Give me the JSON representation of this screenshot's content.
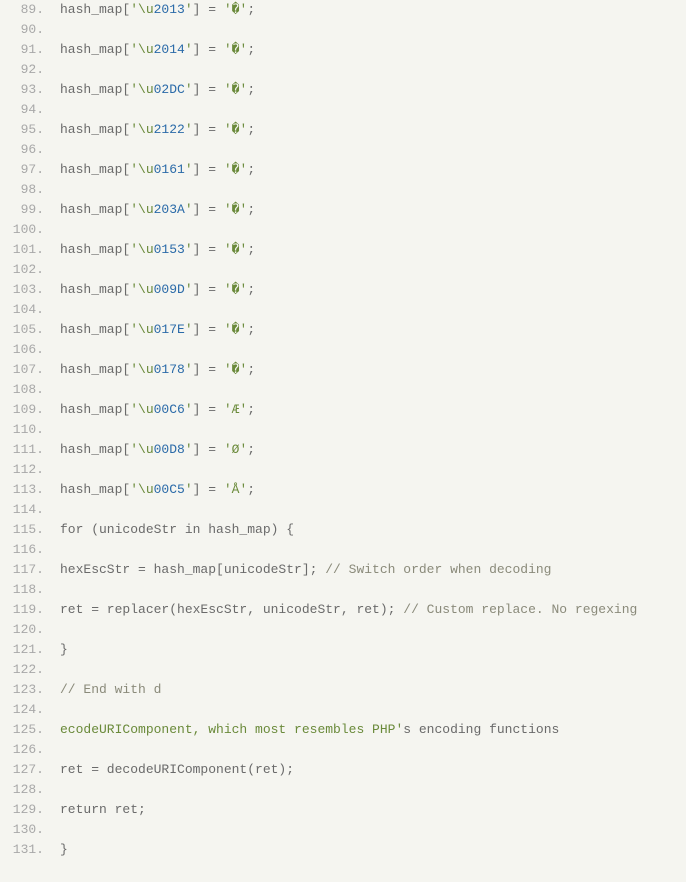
{
  "lines": [
    {
      "num": "89.",
      "tokens": [
        {
          "t": "hash_map[",
          "c": "plain"
        },
        {
          "t": "'\\u",
          "c": "str"
        },
        {
          "t": "2013",
          "c": "esc"
        },
        {
          "t": "'",
          "c": "str"
        },
        {
          "t": "] = ",
          "c": "plain"
        },
        {
          "t": "'�'",
          "c": "str"
        },
        {
          "t": ";",
          "c": "plain"
        }
      ]
    },
    {
      "num": "90.",
      "tokens": []
    },
    {
      "num": "91.",
      "tokens": [
        {
          "t": "hash_map[",
          "c": "plain"
        },
        {
          "t": "'\\u",
          "c": "str"
        },
        {
          "t": "2014",
          "c": "esc"
        },
        {
          "t": "'",
          "c": "str"
        },
        {
          "t": "] = ",
          "c": "plain"
        },
        {
          "t": "'�'",
          "c": "str"
        },
        {
          "t": ";",
          "c": "plain"
        }
      ]
    },
    {
      "num": "92.",
      "tokens": []
    },
    {
      "num": "93.",
      "tokens": [
        {
          "t": "hash_map[",
          "c": "plain"
        },
        {
          "t": "'\\u",
          "c": "str"
        },
        {
          "t": "02DC",
          "c": "esc"
        },
        {
          "t": "'",
          "c": "str"
        },
        {
          "t": "] = ",
          "c": "plain"
        },
        {
          "t": "'�'",
          "c": "str"
        },
        {
          "t": ";",
          "c": "plain"
        }
      ]
    },
    {
      "num": "94.",
      "tokens": []
    },
    {
      "num": "95.",
      "tokens": [
        {
          "t": "hash_map[",
          "c": "plain"
        },
        {
          "t": "'\\u",
          "c": "str"
        },
        {
          "t": "2122",
          "c": "esc"
        },
        {
          "t": "'",
          "c": "str"
        },
        {
          "t": "] = ",
          "c": "plain"
        },
        {
          "t": "'�'",
          "c": "str"
        },
        {
          "t": ";",
          "c": "plain"
        }
      ]
    },
    {
      "num": "96.",
      "tokens": []
    },
    {
      "num": "97.",
      "tokens": [
        {
          "t": "hash_map[",
          "c": "plain"
        },
        {
          "t": "'\\u",
          "c": "str"
        },
        {
          "t": "0161",
          "c": "esc"
        },
        {
          "t": "'",
          "c": "str"
        },
        {
          "t": "] = ",
          "c": "plain"
        },
        {
          "t": "'�'",
          "c": "str"
        },
        {
          "t": ";",
          "c": "plain"
        }
      ]
    },
    {
      "num": "98.",
      "tokens": []
    },
    {
      "num": "99.",
      "tokens": [
        {
          "t": "hash_map[",
          "c": "plain"
        },
        {
          "t": "'\\u",
          "c": "str"
        },
        {
          "t": "203A",
          "c": "esc"
        },
        {
          "t": "'",
          "c": "str"
        },
        {
          "t": "] = ",
          "c": "plain"
        },
        {
          "t": "'�'",
          "c": "str"
        },
        {
          "t": ";",
          "c": "plain"
        }
      ]
    },
    {
      "num": "100.",
      "tokens": []
    },
    {
      "num": "101.",
      "tokens": [
        {
          "t": "hash_map[",
          "c": "plain"
        },
        {
          "t": "'\\u",
          "c": "str"
        },
        {
          "t": "0153",
          "c": "esc"
        },
        {
          "t": "'",
          "c": "str"
        },
        {
          "t": "] = ",
          "c": "plain"
        },
        {
          "t": "'�'",
          "c": "str"
        },
        {
          "t": ";",
          "c": "plain"
        }
      ]
    },
    {
      "num": "102.",
      "tokens": []
    },
    {
      "num": "103.",
      "tokens": [
        {
          "t": "hash_map[",
          "c": "plain"
        },
        {
          "t": "'\\u",
          "c": "str"
        },
        {
          "t": "009D",
          "c": "esc"
        },
        {
          "t": "'",
          "c": "str"
        },
        {
          "t": "] = ",
          "c": "plain"
        },
        {
          "t": "'�'",
          "c": "str"
        },
        {
          "t": ";",
          "c": "plain"
        }
      ]
    },
    {
      "num": "104.",
      "tokens": []
    },
    {
      "num": "105.",
      "tokens": [
        {
          "t": "hash_map[",
          "c": "plain"
        },
        {
          "t": "'\\u",
          "c": "str"
        },
        {
          "t": "017E",
          "c": "esc"
        },
        {
          "t": "'",
          "c": "str"
        },
        {
          "t": "] = ",
          "c": "plain"
        },
        {
          "t": "'�'",
          "c": "str"
        },
        {
          "t": ";",
          "c": "plain"
        }
      ]
    },
    {
      "num": "106.",
      "tokens": []
    },
    {
      "num": "107.",
      "tokens": [
        {
          "t": "hash_map[",
          "c": "plain"
        },
        {
          "t": "'\\u",
          "c": "str"
        },
        {
          "t": "0178",
          "c": "esc"
        },
        {
          "t": "'",
          "c": "str"
        },
        {
          "t": "] = ",
          "c": "plain"
        },
        {
          "t": "'�'",
          "c": "str"
        },
        {
          "t": ";",
          "c": "plain"
        }
      ]
    },
    {
      "num": "108.",
      "tokens": []
    },
    {
      "num": "109.",
      "tokens": [
        {
          "t": "hash_map[",
          "c": "plain"
        },
        {
          "t": "'\\u",
          "c": "str"
        },
        {
          "t": "00C6",
          "c": "esc"
        },
        {
          "t": "'",
          "c": "str"
        },
        {
          "t": "] = ",
          "c": "plain"
        },
        {
          "t": "'Æ'",
          "c": "str"
        },
        {
          "t": ";",
          "c": "plain"
        }
      ]
    },
    {
      "num": "110.",
      "tokens": []
    },
    {
      "num": "111.",
      "tokens": [
        {
          "t": "hash_map[",
          "c": "plain"
        },
        {
          "t": "'\\u",
          "c": "str"
        },
        {
          "t": "00D8",
          "c": "esc"
        },
        {
          "t": "'",
          "c": "str"
        },
        {
          "t": "] = ",
          "c": "plain"
        },
        {
          "t": "'Ø'",
          "c": "str"
        },
        {
          "t": ";",
          "c": "plain"
        }
      ]
    },
    {
      "num": "112.",
      "tokens": []
    },
    {
      "num": "113.",
      "tokens": [
        {
          "t": "hash_map[",
          "c": "plain"
        },
        {
          "t": "'\\u",
          "c": "str"
        },
        {
          "t": "00C5",
          "c": "esc"
        },
        {
          "t": "'",
          "c": "str"
        },
        {
          "t": "] = ",
          "c": "plain"
        },
        {
          "t": "'Å'",
          "c": "str"
        },
        {
          "t": ";",
          "c": "plain"
        }
      ]
    },
    {
      "num": "114.",
      "tokens": []
    },
    {
      "num": "115.",
      "tokens": [
        {
          "t": "for (unicodeStr in hash_map) {",
          "c": "plain"
        }
      ]
    },
    {
      "num": "116.",
      "tokens": []
    },
    {
      "num": "117.",
      "tokens": [
        {
          "t": "hexEscStr = hash_map[unicodeStr]; ",
          "c": "plain"
        },
        {
          "t": "// Switch order when decoding",
          "c": "comment"
        }
      ]
    },
    {
      "num": "118.",
      "tokens": []
    },
    {
      "num": "119.",
      "tokens": [
        {
          "t": "ret = replacer(hexEscStr, unicodeStr, ret); ",
          "c": "plain"
        },
        {
          "t": "// Custom replace. No regexing",
          "c": "comment"
        }
      ]
    },
    {
      "num": "120.",
      "tokens": []
    },
    {
      "num": "121.",
      "tokens": [
        {
          "t": "}",
          "c": "plain"
        }
      ]
    },
    {
      "num": "122.",
      "tokens": []
    },
    {
      "num": "123.",
      "tokens": [
        {
          "t": "// End with d",
          "c": "comment"
        }
      ]
    },
    {
      "num": "124.",
      "tokens": []
    },
    {
      "num": "125.",
      "tokens": [
        {
          "t": "ecodeURIComponent, which most resembles PHP'",
          "c": "str"
        },
        {
          "t": "s encoding functions",
          "c": "plain"
        }
      ]
    },
    {
      "num": "126.",
      "tokens": []
    },
    {
      "num": "127.",
      "tokens": [
        {
          "t": "ret = decodeURIComponent(ret);",
          "c": "plain"
        }
      ]
    },
    {
      "num": "128.",
      "tokens": []
    },
    {
      "num": "129.",
      "tokens": [
        {
          "t": "return ret;",
          "c": "plain"
        }
      ]
    },
    {
      "num": "130.",
      "tokens": []
    },
    {
      "num": "131.",
      "tokens": [
        {
          "t": "}",
          "c": "plain"
        }
      ]
    }
  ]
}
